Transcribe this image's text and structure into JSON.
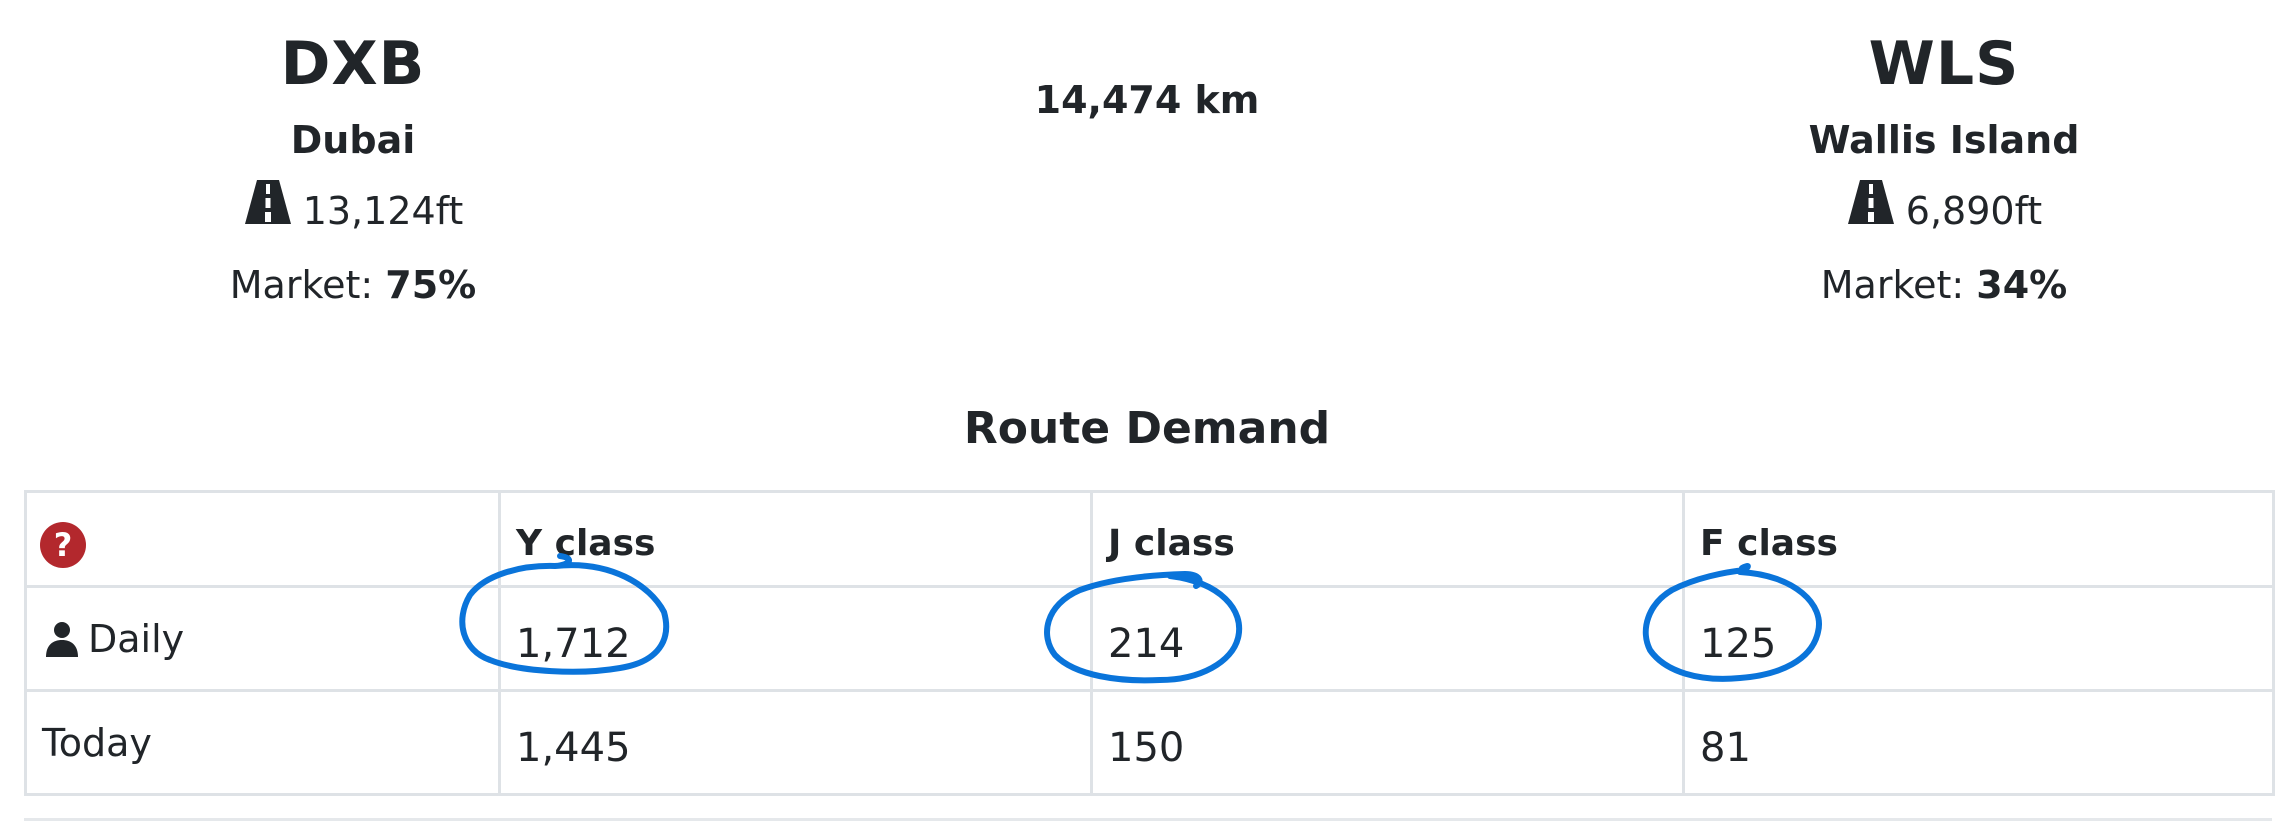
{
  "origin": {
    "code": "DXB",
    "city": "Dubai",
    "runway": "13,124ft",
    "market_label": "Market:",
    "market_value": "75%"
  },
  "destination": {
    "code": "WLS",
    "city": "Wallis Island",
    "runway": "6,890ft",
    "market_label": "Market:",
    "market_value": "34%"
  },
  "distance": "14,474 km",
  "route_demand": {
    "title": "Route Demand",
    "help_icon": "question-circle-icon",
    "columns": [
      "Y class",
      "J class",
      "F class"
    ],
    "rows": [
      {
        "label": "Daily",
        "icon": "person-icon",
        "values": [
          "1,712",
          "214",
          "125"
        ]
      },
      {
        "label": "Today",
        "values": [
          "1,445",
          "150",
          "81"
        ]
      }
    ]
  },
  "colors": {
    "text": "#212529",
    "border": "#dee2e6",
    "help_icon": "#b3282d",
    "annotation": "#0a74da"
  }
}
